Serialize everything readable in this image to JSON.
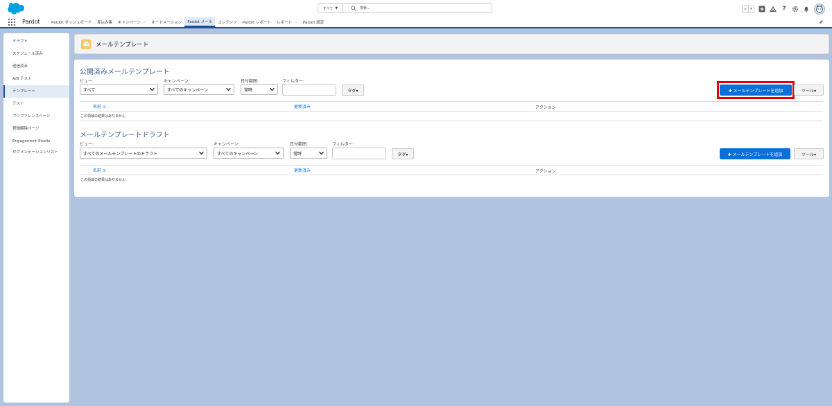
{
  "header": {
    "search_scope": "すべて",
    "search_placeholder": "検索..."
  },
  "nav": {
    "app_name": "Pardot",
    "items": [
      {
        "label": "Pardot ダッシュボード",
        "has_menu": false
      },
      {
        "label": "見込み客",
        "has_menu": false
      },
      {
        "label": "キャンペーン",
        "has_menu": true
      },
      {
        "label": "オートメーション",
        "has_menu": false
      },
      {
        "label": "Pardot メール",
        "has_menu": false,
        "active": true
      },
      {
        "label": "コンテンツ",
        "has_menu": false
      },
      {
        "label": "Pardot レポート",
        "has_menu": false
      },
      {
        "label": "レポート",
        "has_menu": true
      },
      {
        "label": "Pardot 設定",
        "has_menu": false
      }
    ]
  },
  "sidebar": {
    "items": [
      {
        "label": "ドラフト"
      },
      {
        "label": "スケジュール済み"
      },
      {
        "label": "送信済み"
      },
      {
        "label": "A/B テスト"
      },
      {
        "label": "テンプレート",
        "active": true
      },
      {
        "label": "テスト"
      },
      {
        "label": "プリファレンスページ"
      },
      {
        "label": "登録解除ページ"
      },
      {
        "label": "Engagement Studio"
      },
      {
        "label": "セグメンテーションリスト"
      }
    ]
  },
  "page": {
    "title": "メールテンプレート"
  },
  "published": {
    "title": "公開済みメールテンプレート",
    "view_label": "ビュー:",
    "view_value": "すべて",
    "campaign_label": "キャンペーン:",
    "campaign_value": "すべてのキャンペーン",
    "date_label": "日付範囲:",
    "date_value": "常時",
    "filter_label": "フィルター:",
    "tag_button": "タグ▾",
    "add_button": "✚ メールテンプレートを追加",
    "tools_button": "ツール▾",
    "col_name": "名前 ⊙",
    "col_updated": "更新済み",
    "col_action": "アクション",
    "empty": "この領域の結果はありません"
  },
  "drafts": {
    "title": "メールテンプレートドラフト",
    "view_label": "ビュー:",
    "view_value": "すべてのメールテンプレートのドラフト",
    "campaign_label": "キャンペーン:",
    "campaign_value": "すべてのキャンペーン",
    "date_label": "日付範囲:",
    "date_value": "常時",
    "filter_label": "フィルター:",
    "tag_button": "タグ▾",
    "add_button": "✚ メールテンプレートを追加",
    "tools_button": "ツール▾",
    "col_name": "名前 ⊙",
    "col_updated": "更新済み",
    "col_action": "アクション",
    "empty": "この領域の結果はありません"
  },
  "colors": {
    "brand_blue": "#0a6fd9",
    "nav_accent": "#1b5297",
    "highlight": "#e30000",
    "background": "#b0c4df"
  },
  "icons": [
    "salesforce-cloud-icon",
    "search-icon",
    "star-icon",
    "plus-icon",
    "trailhead-icon",
    "help-icon",
    "gear-icon",
    "bell-icon",
    "avatar",
    "app-launcher-icon",
    "pencil-icon",
    "envelope-icon"
  ]
}
